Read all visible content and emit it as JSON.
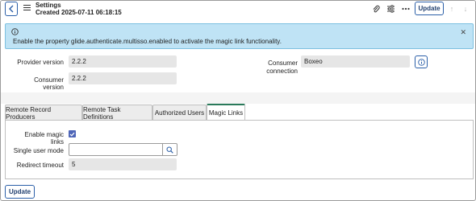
{
  "header": {
    "title": "Settings",
    "subtitle": "Created 2025-07-11 06:18:15",
    "update_label": "Update",
    "icons": [
      "chevron-left-icon",
      "menu-icon",
      "paperclip-icon",
      "sliders-icon",
      "more-icon",
      "arrow-up-icon",
      "arrow-down-icon"
    ]
  },
  "banner": {
    "message": "Enable the property glide.authenticate.multisso.enabled to activate the magic link functionality.",
    "icons": [
      "info-icon",
      "close-icon"
    ],
    "bg_color": "#bfe3f5"
  },
  "fields": {
    "provider_version_label": "Provider version",
    "provider_version_value": "2.2.2",
    "consumer_version_label": "Consumer version",
    "consumer_version_value": "2.2.2",
    "consumer_connection_label_1": "Consumer",
    "consumer_connection_label_2": "connection",
    "consumer_connection_value": "Boxeo"
  },
  "tabs": [
    {
      "label": "Remote Record Producers",
      "active": false
    },
    {
      "label": "Remote Task Definitions",
      "active": false
    },
    {
      "label": "Authorized Users",
      "active": false
    },
    {
      "label": "Magic Links",
      "active": true
    }
  ],
  "magic_links": {
    "enable_label": "Enable magic links",
    "enable_checked": true,
    "single_user_mode_label": "Single user mode",
    "single_user_mode_value": "",
    "redirect_timeout_label": "Redirect timeout",
    "redirect_timeout_value": "5"
  },
  "footer": {
    "update_label": "Update"
  },
  "colors": {
    "accent": "#2b5fa8",
    "active_tab": "#2a7a5a",
    "checkbox": "#4f66b8"
  }
}
